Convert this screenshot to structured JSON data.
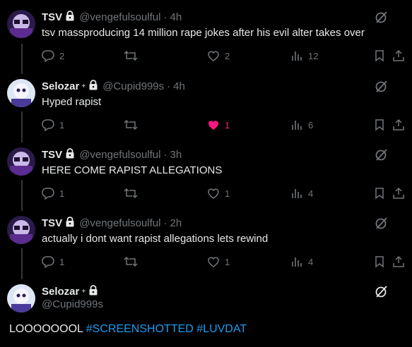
{
  "colors": {
    "background": "#000000",
    "text": "#e7e9ea",
    "muted": "#71767b",
    "like_active": "#f91880",
    "hashtag": "#1d9bf0",
    "thread_line": "#333639"
  },
  "tweets": [
    {
      "name": "TSV",
      "handle": "@vengefulsoulful",
      "separator": "·",
      "time": "4h",
      "text": "tsv massproducing 14 million rape jokes after his evil alter takes over",
      "replies": "2",
      "retweets": "",
      "likes": "2",
      "views": "12",
      "liked": false,
      "avatar": "tsv"
    },
    {
      "name": "Selozar",
      "handle": "@Cupid999s",
      "separator": "·",
      "time": "4h",
      "text": "Hyped rapist",
      "replies": "1",
      "retweets": "",
      "likes": "1",
      "views": "6",
      "liked": true,
      "avatar": "selozar"
    },
    {
      "name": "TSV",
      "handle": "@vengefulsoulful",
      "separator": "·",
      "time": "3h",
      "text": "HERE COME RAPIST ALLEGATIONS",
      "replies": "1",
      "retweets": "",
      "likes": "1",
      "views": "4",
      "liked": false,
      "avatar": "tsv"
    },
    {
      "name": "TSV",
      "handle": "@vengefulsoulful",
      "separator": "·",
      "time": "2h",
      "text": "actually i dont want rapist allegations lets rewind",
      "replies": "1",
      "retweets": "",
      "likes": "1",
      "views": "4",
      "liked": false,
      "avatar": "tsv"
    }
  ],
  "focused": {
    "name": "Selozar",
    "handle": "@Cupid999s",
    "text_plain": "LOOOOOOOL",
    "hashtag1": "#SCREENSHOTTED",
    "hashtag2": "#LUVDAT"
  },
  "icons": {
    "lock": "lock-icon",
    "reply": "reply-icon",
    "retweet": "retweet-icon",
    "like": "heart-icon",
    "views": "views-icon",
    "bookmark": "bookmark-icon",
    "share": "share-icon",
    "grok": "grok-icon"
  }
}
